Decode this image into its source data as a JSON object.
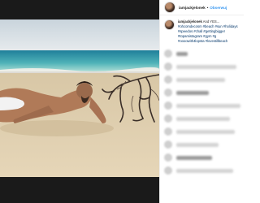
{
  "post": {
    "username": "iamjackjelonek",
    "separator": "•",
    "follow_label": "Obserwuj",
    "caption_user": "iamjackjelonek",
    "caption_text": "And YES... ",
    "caption_tags": "#ohcomdecosm #beach #sun #holidays #speedos #chall #gettingbigger #topamistagram #gym #g #oooowith4lopsta #lovestillbeach"
  },
  "comments_blurred": true,
  "colors": {
    "link": "#3897f0",
    "hashtag": "#003569",
    "text": "#262626",
    "sand": "#d9c6a3",
    "sea": "#6fc1c4"
  }
}
